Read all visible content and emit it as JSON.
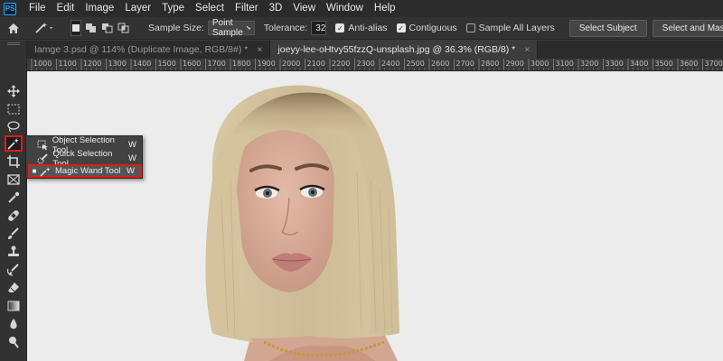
{
  "menubar": {
    "app_icon": "PS",
    "items": [
      "File",
      "Edit",
      "Image",
      "Layer",
      "Type",
      "Select",
      "Filter",
      "3D",
      "View",
      "Window",
      "Help"
    ]
  },
  "options": {
    "sample_size_label": "Sample Size:",
    "sample_size_value": "Point Sample",
    "tolerance_label": "Tolerance:",
    "tolerance_value": "32",
    "anti_alias_label": "Anti-alias",
    "anti_alias_checked": true,
    "contiguous_label": "Contiguous",
    "contiguous_checked": true,
    "sample_all_layers_label": "Sample All Layers",
    "sample_all_layers_checked": false,
    "select_subject_label": "Select Subject",
    "select_and_mask_label": "Select and Mask..."
  },
  "tabs": [
    {
      "label": "Iamge 3.psd @ 114% (Duplicate Image, RGB/8#) *",
      "active": false
    },
    {
      "label": "joeyy-lee-oHtvy55fzzQ-unsplash.jpg @ 36.3% (RGB/8) *",
      "active": true
    }
  ],
  "tab_close": "×",
  "ruler": {
    "labels": [
      "1000",
      "1100",
      "1200",
      "1300",
      "1400",
      "1500",
      "1600",
      "1700",
      "1800",
      "1900",
      "2000",
      "2100",
      "2200",
      "2300",
      "2400",
      "2500",
      "2600",
      "2700",
      "2800",
      "2900",
      "3000",
      "3100",
      "3200",
      "3300",
      "3400",
      "3500",
      "3600",
      "3700"
    ]
  },
  "flyout": {
    "items": [
      {
        "label": "Object Selection Tool",
        "shortcut": "W",
        "icon": "object-selection-icon",
        "selected": false
      },
      {
        "label": "Quick Selection Tool",
        "shortcut": "W",
        "icon": "quick-selection-icon",
        "selected": false
      },
      {
        "label": "Magic Wand Tool",
        "shortcut": "W",
        "icon": "magic-wand-icon",
        "selected": true
      }
    ],
    "selected_bullet": "■"
  },
  "tools": [
    "move-icon",
    "marquee-icon",
    "lasso-icon",
    "magic-wand-icon",
    "crop-icon",
    "frame-icon",
    "eyedropper-icon",
    "healing-brush-icon",
    "brush-icon",
    "clone-stamp-icon",
    "history-brush-icon",
    "eraser-icon",
    "gradient-icon",
    "blur-icon",
    "dodge-icon"
  ],
  "colors": {
    "highlight": "#e01b1b",
    "canvas_bg": "#ececec",
    "panel_bg": "#323232"
  }
}
